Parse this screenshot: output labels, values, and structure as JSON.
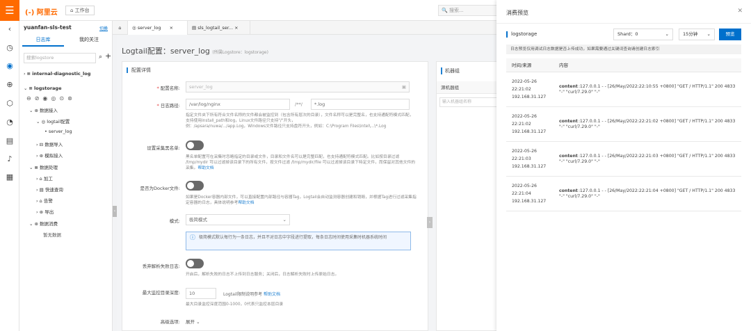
{
  "topbar": {
    "menu_icon": "hamburger-icon",
    "logo": "阿里云",
    "workbench": "工作台",
    "search_placeholder": "搜索..."
  },
  "colors": {
    "brand": "#ff6a00",
    "accent": "#0070cc"
  },
  "rail": {
    "icons": [
      "chevron-left-icon",
      "clock-icon",
      "logstore-icon",
      "search-icon",
      "cube-icon",
      "chart-icon",
      "file-icon",
      "bell-icon",
      "grid-icon"
    ]
  },
  "left": {
    "project": "yuanfan-sls-test",
    "switch": "切换",
    "tabs": [
      "日志库",
      "我的关注"
    ],
    "search_placeholder": "搜索logstore",
    "tree": [
      "internal-diagnostic_log",
      "logstorage",
      "数据接入",
      "logtail配置",
      "server_log",
      "数据导入",
      "模拟接入",
      "数据处理",
      "加工",
      "快速查询",
      "告警",
      "导出",
      "数据消费",
      "暂无数据"
    ]
  },
  "tabs": [
    "server_log",
    "sls_logtail_ser..."
  ],
  "page": {
    "title": "Logtail配置：server_log",
    "subtitle": "(所属Logstore：logstorage)",
    "section": "配置详情",
    "fields": {
      "config_name_label": "配置名称:",
      "config_name_value": "server_log",
      "log_path_label": "日志路径:",
      "log_path_value": "/var/log/nginx",
      "log_path_mid": "/**/",
      "log_path_pattern": "*.log",
      "log_path_help": "指定文件夹下所有符合文件名称的文件都会被监控到（包含所有层次的目录），文件名称可以是完整名，也支持通配符模式匹配，支持使用install_path和log，Linux文件路径只支持\"/\"开头，",
      "log_path_help2": "例：/apsara/nuwa/.../app.Log，Windows文件路径只支持盘符开头，例如：C:\\Program Files\\Intel\\...\\*.Log",
      "blacklist_label": "设置采集黑名单:",
      "blacklist_help": "黑名单配置可在采集时忽略指定的目录或文件，目录和文件名可以是完整匹配，也支持通配符模式匹配。比如按目录过滤 /tmp/mydir 可以过滤掉该目录下的所有文件，按文件过滤 /tmp/mydir/file 可以过滤掉该目录下特定文件，而保留对其他文件的采集。",
      "blacklist_link": "帮助文档",
      "docker_label": "是否为Docker文件:",
      "docker_help": "如果是Docker容器内部文件，可以直接配置内部路径与容器Tag，Logtail会自动监测容器创建和销毁，并根据Tag进行过滤采集指定容器的日志，具体说明参考",
      "docker_link": "帮助文档",
      "mode_label": "模式:",
      "mode_value": "极简模式",
      "mode_info": "极简模式默认每行为一条日志，并且不对日志中字段进行提取，每条日志时间使用采集时机器系统时间",
      "drop_label": "丢弃解析失败日志:",
      "drop_help": "开启后，解析失败的日志不上传到日志服务；关闭后，日志解析失败时上传原始日志。",
      "depth_label": "最大监控目录深度:",
      "depth_value": "10",
      "depth_hint": "Logtail限制说明参考",
      "depth_link": "帮助文档",
      "depth_help": "最大目录监控深度范围0-1000，0代表只监控本层目录",
      "advanced_label": "高级选项:",
      "advanced_value": "展开"
    }
  },
  "machine": {
    "title": "机器组",
    "col": "源机器组",
    "placeholder": "输入机器组名称"
  },
  "drawer": {
    "title": "消费预览",
    "logstore": "logstorage",
    "shard": "Shard：0",
    "range": "15分钟",
    "preview_btn": "预览",
    "note": "日志预览仅用调试日志数据是否上传成功，如果需要通过关键词查询请创建日志索引",
    "col_time": "时间/来源",
    "col_content": "内容",
    "rows": [
      {
        "time": "2022-05-26 22:21:02",
        "ip": "192.168.31.127",
        "key": "content",
        "value": ":127.0.0.1 - - [26/May/2022:22:10:55 +0800] \"GET / HTTP/1.1\" 200 4833 \"-\" \"curl/7.29.0\" \"-\""
      },
      {
        "time": "2022-05-26 22:21:02",
        "ip": "192.168.31.127",
        "key": "content",
        "value": ":127.0.0.1 - - [26/May/2022:22:21:02 +0800] \"GET / HTTP/1.1\" 200 4833 \"-\" \"curl/7.29.0\" \"-\""
      },
      {
        "time": "2022-05-26 22:21:03",
        "ip": "192.168.31.127",
        "key": "content",
        "value": ":127.0.0.1 - - [26/May/2022:22:21:03 +0800] \"GET / HTTP/1.1\" 200 4833 \"-\" \"curl/7.29.0\" \"-\""
      },
      {
        "time": "2022-05-26 22:21:04",
        "ip": "192.168.31.127",
        "key": "content",
        "value": ":127.0.0.1 - - [26/May/2022:22:21:04 +0800] \"GET / HTTP/1.1\" 200 4833 \"-\" \"curl/7.29.0\" \"-\""
      }
    ]
  }
}
